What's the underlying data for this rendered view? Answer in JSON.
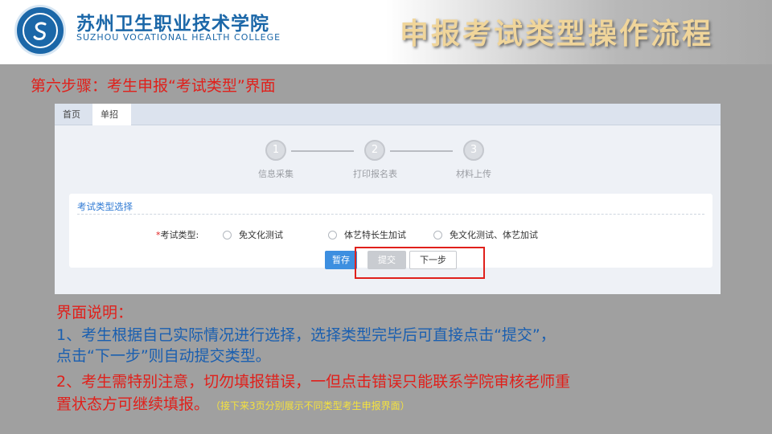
{
  "header": {
    "college_name": "苏州卫生职业技术学院",
    "college_name_en": "SUZHOU VOCATIONAL HEALTH COLLEGE",
    "slide_title": "申报考试类型操作流程"
  },
  "step_heading": "第六步骤：考生申报“考试类型”界面",
  "app": {
    "tabs": [
      {
        "label": "首页"
      },
      {
        "label": "单招"
      }
    ],
    "steps": [
      {
        "number": "1",
        "label": "信息采集"
      },
      {
        "number": "2",
        "label": "打印报名表"
      },
      {
        "number": "3",
        "label": "材料上传"
      }
    ],
    "card": {
      "title": "考试类型选择",
      "required_mark": "*",
      "field_label": "考试类型:",
      "options": [
        {
          "label": "免文化测试"
        },
        {
          "label": "体艺特长生加试"
        },
        {
          "label": "免文化测试、体艺加试"
        }
      ]
    },
    "buttons": {
      "save": "暂存",
      "submit": "提交",
      "next": "下一步"
    }
  },
  "description": {
    "title": "界面说明：",
    "line1a": "1、考生根据自己实际情况进行选择，选择类型完毕后可直接点击“提交”，",
    "line1b": "点击“下一步”则自动提交类型。",
    "line2a": "2、考生需特别注意，切勿填报错误，一但点击错误只能联系学院审核老师重",
    "line2b": "置状态方可继续填报。",
    "note": "（接下来3页分别展示不同类型考生申报界面）"
  },
  "colors": {
    "accent_blue": "#3d8fe0",
    "highlight_red": "#e0201b",
    "brand_blue": "#1b67a8"
  }
}
